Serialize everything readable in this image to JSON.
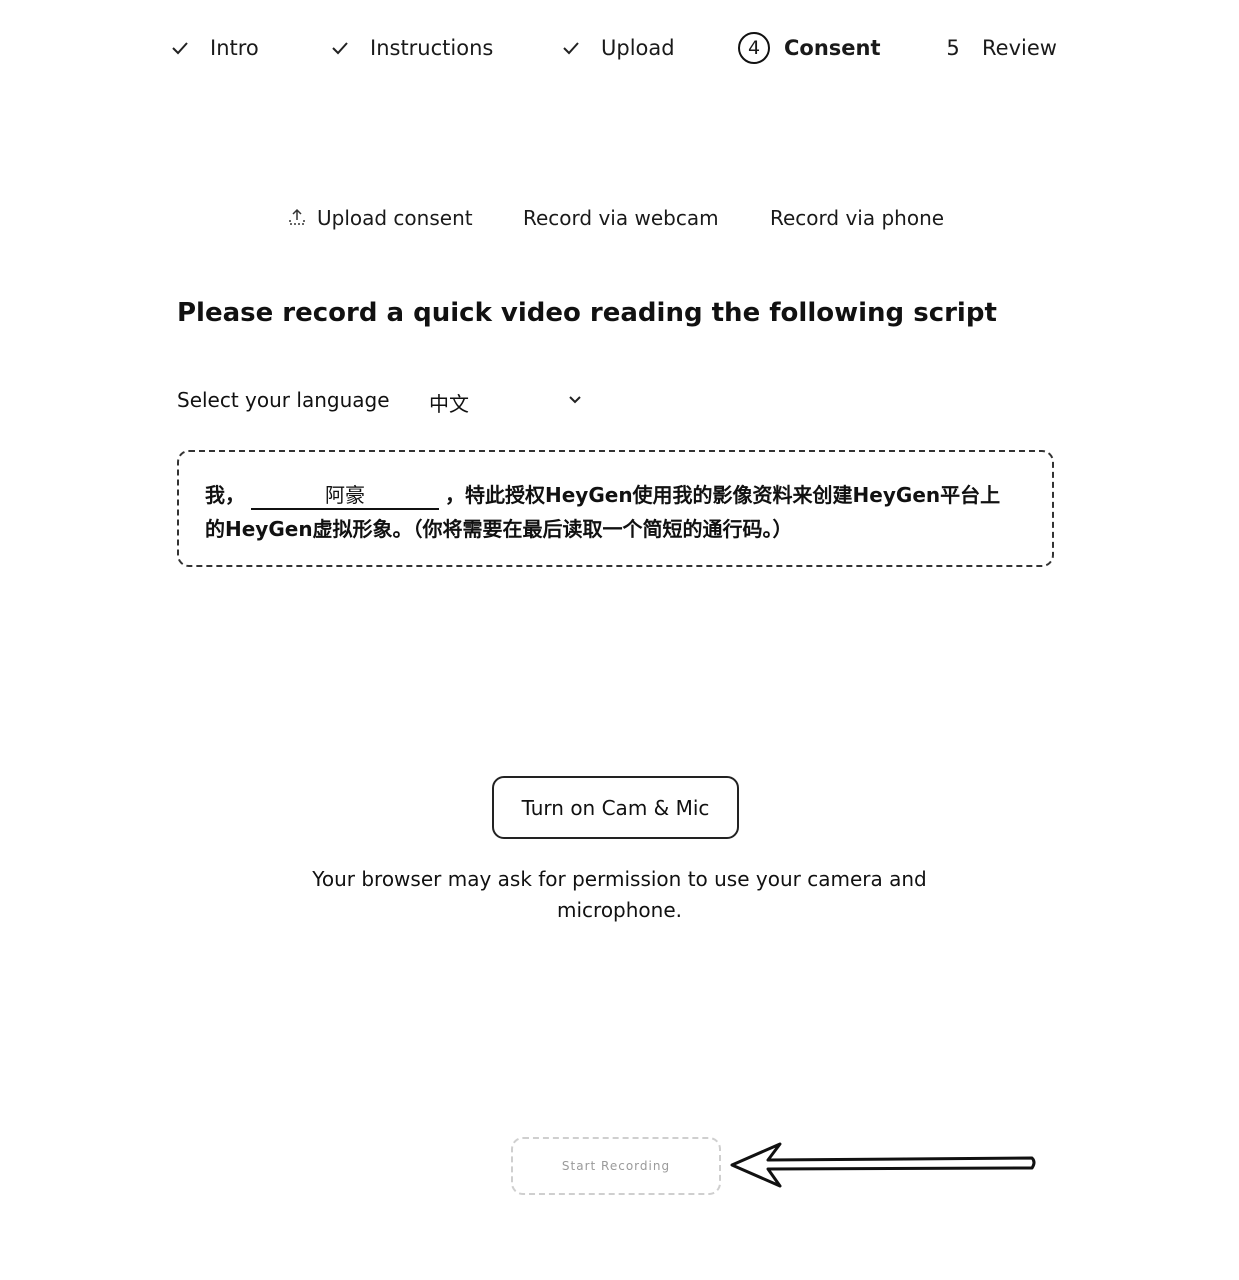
{
  "stepper": {
    "steps": [
      {
        "label": "Intro",
        "state": "done"
      },
      {
        "label": "Instructions",
        "state": "done"
      },
      {
        "label": "Upload",
        "state": "done"
      },
      {
        "label": "Consent",
        "number": "4",
        "state": "active"
      },
      {
        "label": "Review",
        "number": "5",
        "state": "pending"
      }
    ]
  },
  "tabs": {
    "upload_consent": "Upload consent",
    "record_webcam": "Record via webcam",
    "record_phone": "Record via phone"
  },
  "page_title": "Please record a quick video reading the following script",
  "language": {
    "label": "Select your language",
    "selected": "中文"
  },
  "script": {
    "prefix": "我，",
    "name": "阿豪",
    "line1_rest": "，特此授权HeyGen使用我的影像资料来创建HeyGen平台上",
    "line2": "的HeyGen虚拟形象。（你将需要在最后读取一个简短的通行码。）"
  },
  "cam_button_label": "Turn on Cam & Mic",
  "permission_notice": {
    "line1": "Your browser may ask for permission to use your camera and",
    "line2": "microphone."
  },
  "start_button_label": "Start Recording"
}
